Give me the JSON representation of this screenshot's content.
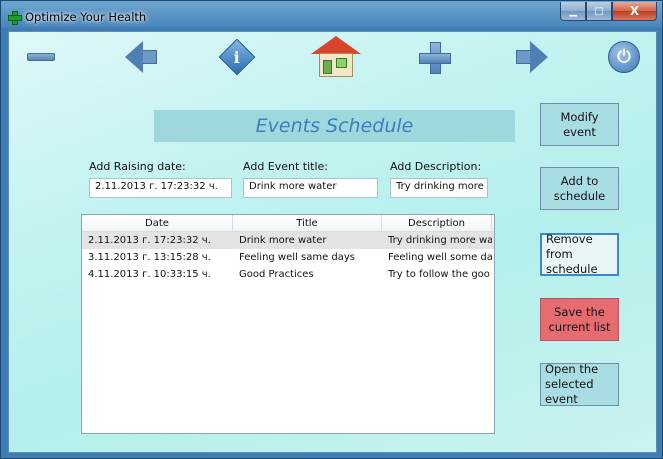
{
  "window": {
    "title": "Optimize Your Health",
    "minimize_glyph": "▁",
    "maximize_glyph": "□",
    "close_glyph": "X"
  },
  "toolbar": {
    "icons": [
      "minus-icon",
      "back-arrow-icon",
      "info-icon",
      "home-icon",
      "plus-icon",
      "forward-arrow-icon",
      "power-icon"
    ],
    "info_glyph": "i",
    "power_glyph": "⏻"
  },
  "heading": "Events Schedule",
  "form": {
    "date_label": "Add Raising date:",
    "date_value": "2.11.2013 г. 17:23:32 ч.",
    "title_label": "Add Event title:",
    "title_value": "Drink more water",
    "description_label": "Add Description:",
    "description_value": "Try drinking more wa"
  },
  "table": {
    "columns": [
      "Date",
      "Title",
      "Description"
    ],
    "rows": [
      {
        "date": "2.11.2013 г. 17:23:32 ч.",
        "title": "Drink more water",
        "description": "Try drinking more wa",
        "selected": true
      },
      {
        "date": "3.11.2013 г. 13:15:28 ч.",
        "title": "Feeling well same days",
        "description": "Feeling well some day",
        "selected": false
      },
      {
        "date": "4.11.2013 г. 10:33:15 ч.",
        "title": "Good Practices",
        "description": "Try to follow the goo",
        "selected": false
      }
    ]
  },
  "buttons": {
    "modify": "Modify event",
    "add": "Add to schedule",
    "remove": "Remove from schedule",
    "save": "Save the current list",
    "open": "Open the selected event"
  },
  "colors": {
    "heading_text": "#3b7fbe",
    "save_button": "#e66c72",
    "client_background": "#c4f3f1"
  }
}
